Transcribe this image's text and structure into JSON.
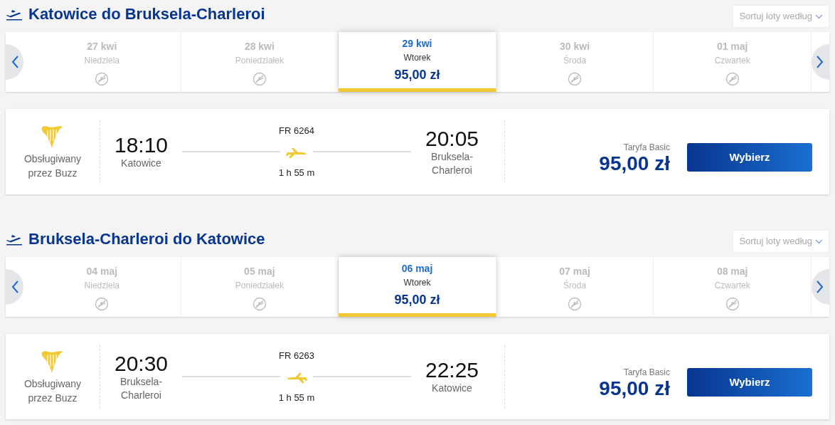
{
  "legs": [
    {
      "title": "Katowice do Bruksela-Charleroi",
      "sort_label": "Sortuj loty według",
      "reversed": false,
      "dates": [
        {
          "date": "27 kwi",
          "day": "Niedziela",
          "available": false,
          "selected": false
        },
        {
          "date": "28 kwi",
          "day": "Poniedziałek",
          "available": false,
          "selected": false
        },
        {
          "date": "29 kwi",
          "day": "Wtorek",
          "available": true,
          "price": "95,00 zł",
          "selected": true
        },
        {
          "date": "30 kwi",
          "day": "Środa",
          "available": false,
          "selected": false
        },
        {
          "date": "01 maj",
          "day": "Czwartek",
          "available": false,
          "selected": false
        }
      ],
      "flight": {
        "operator": "Obsługiwany przez Buzz",
        "depart_time": "18:10",
        "depart_city": "Katowice",
        "number": "FR 6264",
        "duration": "1 h 55 m",
        "arrive_time": "20:05",
        "arrive_city": "Bruksela-Charleroi",
        "fare": "Taryfa Basic",
        "price": "95,00 zł",
        "button": "Wybierz"
      }
    },
    {
      "title": "Bruksela-Charleroi do Katowice",
      "sort_label": "Sortuj loty według",
      "reversed": true,
      "dates": [
        {
          "date": "04 maj",
          "day": "Niedziela",
          "available": false,
          "selected": false
        },
        {
          "date": "05 maj",
          "day": "Poniedziałek",
          "available": false,
          "selected": false
        },
        {
          "date": "06 maj",
          "day": "Wtorek",
          "available": true,
          "price": "95,00 zł",
          "selected": true
        },
        {
          "date": "07 maj",
          "day": "Środa",
          "available": false,
          "selected": false
        },
        {
          "date": "08 maj",
          "day": "Czwartek",
          "available": false,
          "selected": false
        }
      ],
      "flight": {
        "operator": "Obsługiwany przez Buzz",
        "depart_time": "20:30",
        "depart_city": "Bruksela-Charleroi",
        "number": "FR 6263",
        "duration": "1 h 55 m",
        "arrive_time": "22:25",
        "arrive_city": "Katowice",
        "fare": "Taryfa Basic",
        "price": "95,00 zł",
        "button": "Wybierz"
      }
    }
  ]
}
